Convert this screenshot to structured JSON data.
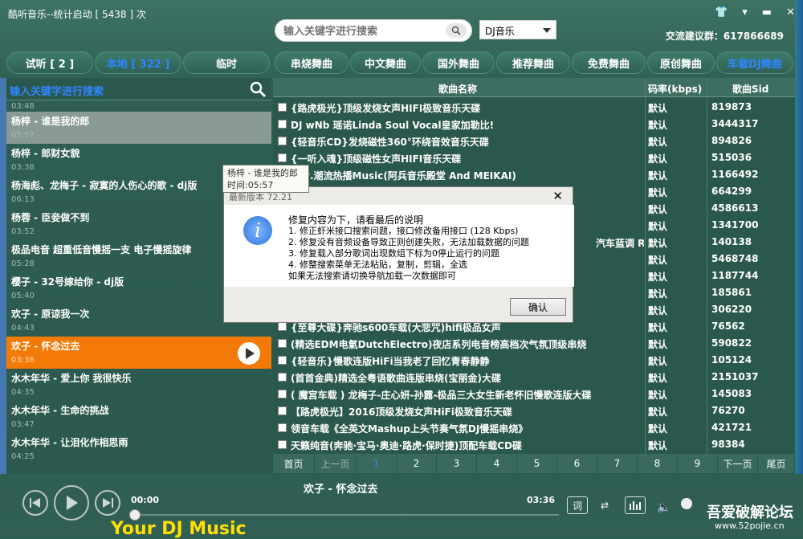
{
  "window": {
    "title": "酷听音乐--统计启动 [  5438  ] 次",
    "qq_group": "交流建议群：617866689"
  },
  "search": {
    "placeholder": "输入关键字进行搜索",
    "source": "DJ音乐"
  },
  "tabs": [
    {
      "label": "试听 [ 2 ]"
    },
    {
      "label": "本地 [ 322 ]"
    },
    {
      "label": "临时"
    },
    {
      "label": "串烧舞曲"
    },
    {
      "label": "中文舞曲"
    },
    {
      "label": "国外舞曲"
    },
    {
      "label": "推荐舞曲"
    },
    {
      "label": "免费舞曲"
    },
    {
      "label": "原创舞曲"
    },
    {
      "label": "车载DJ舞曲"
    }
  ],
  "left": {
    "search_label": "输入关键字进行搜索",
    "first_time": "03:48",
    "items": [
      {
        "title": "杨梓 - 谁是我的郎",
        "time": "05:57"
      },
      {
        "title": "杨梓 - 郎财女貌",
        "time": "03:38"
      },
      {
        "title": "杨海彪、龙梅子 - 寂寞的人伤心的歌 - dj版",
        "time": "06:13"
      },
      {
        "title": "杨蓉 - 臣妾做不到",
        "time": "03:52"
      },
      {
        "title": "极品电音 超重低音慢摇一支 电子慢摇旋律",
        "time": "05:28"
      },
      {
        "title": "樱子 - 32号嫁给你 - dj版",
        "time": "05:40"
      },
      {
        "title": "欢子 - 原谅我一次",
        "time": "04:43"
      },
      {
        "title": "欢子 - 怀念过去",
        "time": "03:36"
      },
      {
        "title": "水木年华 - 爱上你 我很快乐",
        "time": "04:35"
      },
      {
        "title": "水木年华 - 生命的挑战",
        "time": "03:47"
      },
      {
        "title": "水木年华 - 让泪化作相思雨",
        "time": "04:25"
      }
    ]
  },
  "table": {
    "headers": {
      "name": "歌曲名称",
      "rate": "码率(kbps)",
      "sid": "歌曲Sid"
    },
    "rows": [
      {
        "name": "{路虎极光}顶级发烧女声HIFI极致音乐天碟",
        "rate": "默认",
        "sid": "819873"
      },
      {
        "name": "DJ wNb 瑶诺Linda Soul Vocal皇家加勒比!",
        "rate": "默认",
        "sid": "3444317"
      },
      {
        "name": "{轻音乐CD}发烧磁性360°环绕音效音乐天碟",
        "rate": "默认",
        "sid": "894826"
      },
      {
        "name": "{一听入魂}顶级磁性女声HIFI音乐天碟",
        "rate": "默认",
        "sid": "515036"
      },
      {
        "name": "骑士.潮流热播Music(阿兵音乐殿堂 And MEIKAI)",
        "rate": "默认",
        "sid": "1166492"
      },
      {
        "name": "",
        "rate": "默认",
        "sid": "664299"
      },
      {
        "name": "",
        "rate": "默认",
        "sid": "4586613"
      },
      {
        "name": "",
        "rate": "默认",
        "sid": "1341700"
      },
      {
        "name": "汽车蓝调 Rnb",
        "rate": "默认",
        "sid": "140138"
      },
      {
        "name": "",
        "rate": "默认",
        "sid": "5468748"
      },
      {
        "name": "",
        "rate": "默认",
        "sid": "1187744"
      },
      {
        "name": "",
        "rate": "默认",
        "sid": "185861"
      },
      {
        "name": "",
        "rate": "默认",
        "sid": "306220"
      },
      {
        "name": "{至尊大碟}奔驰s600车载(大悲咒)hifi极品女声",
        "rate": "默认",
        "sid": "76562"
      },
      {
        "name": "(精选EDM电氣DutchElectro)夜店系列电音榜高档次气氛顶级串烧",
        "rate": "默认",
        "sid": "590822"
      },
      {
        "name": "{轻音乐}慢歌连版HiFi当我老了回忆青春静静",
        "rate": "默认",
        "sid": "105124"
      },
      {
        "name": "(首首金典)精选全粤语歌曲连版串烧(宝丽金)大碟",
        "rate": "默认",
        "sid": "2151037"
      },
      {
        "name": "( 魔宫车载 ) 龙梅子-庄心妍-孙露-极品三大女生新老怀旧慢歌连版大碟",
        "rate": "默认",
        "sid": "145083"
      },
      {
        "name": "【路虎极光】2016顶级发烧女声HiFi极致音乐天碟",
        "rate": "默认",
        "sid": "76270"
      },
      {
        "name": "领音车载《全英文Mashup上头节奏气氛DJ慢摇串烧》",
        "rate": "默认",
        "sid": "421721"
      },
      {
        "name": "天籁纯音(奔驰·宝马·奥迪·路虎·保时捷)顶配车载CD碟",
        "rate": "默认",
        "sid": "98384"
      }
    ]
  },
  "pager": {
    "first": "首页",
    "prev": "上一页",
    "pages": [
      "1",
      "2",
      "3",
      "4",
      "5",
      "6",
      "7",
      "8",
      "9"
    ],
    "next": "下一页",
    "last": "尾页"
  },
  "player": {
    "now_playing": "欢子 - 怀念过去",
    "elapsed": "00:00",
    "duration": "03:36",
    "progress": 0,
    "lyric_btn": "词",
    "mode_btn": "⇄",
    "brand": "Your DJ Music"
  },
  "tooltip": {
    "title": "杨梓 - 谁是我的郎",
    "time": "时间:05:57"
  },
  "dialog": {
    "title": "最新版本  72.21",
    "lines": [
      "修复内容为下，请看最后的说明",
      "1. 修正虾米接口搜索问题，接口修改备用接口 (128 Kbps)",
      "2. 修复没有音频设备导致正则创建失败，无法加载数据的问题",
      "3. 修复载入部分歌词出现数组下标为0停止运行的问题",
      "4. 修整搜索菜单无法粘贴，复制，剪辑，全选",
      "如果无法搜索请切换导航加载一次数据即可"
    ],
    "ok": "确认"
  },
  "watermark": {
    "text": "吾爱破解论坛",
    "url": "www.52pojie.cn"
  },
  "colors": {
    "accent_orange": "#f47a07",
    "tab_blue": "#2f86ff",
    "brand_yellow": "#ffe000"
  }
}
